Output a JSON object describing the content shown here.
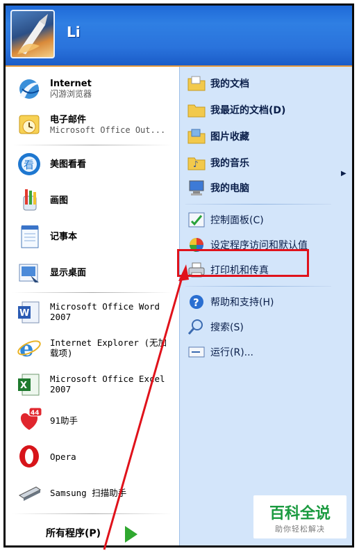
{
  "user": {
    "name": "Li"
  },
  "pinned": [
    {
      "title": "Internet",
      "subtitle": "闪游浏览器",
      "icon": "browser-icon"
    },
    {
      "title": "电子邮件",
      "subtitle": "Microsoft Office Out...",
      "icon": "outlook-icon"
    }
  ],
  "recent": [
    {
      "label": "美图看看",
      "icon": "image-viewer-icon"
    },
    {
      "label": "画图",
      "icon": "paint-icon"
    },
    {
      "label": "记事本",
      "icon": "notepad-icon"
    },
    {
      "label": "显示桌面",
      "icon": "show-desktop-icon"
    }
  ],
  "recent2": [
    {
      "line1": "Microsoft Office Word",
      "line2": "2007",
      "icon": "word-icon"
    },
    {
      "line1": "Internet Explorer (无加",
      "line2": "载项)",
      "icon": "ie-icon"
    },
    {
      "line1": "Microsoft Office Excel",
      "line2": "2007",
      "icon": "excel-icon"
    },
    {
      "line1": "91助手",
      "line2": "",
      "icon": "91-assistant-icon",
      "badge": "44"
    },
    {
      "line1": "Opera",
      "line2": "",
      "icon": "opera-icon"
    },
    {
      "line1": "Samsung 扫描助手",
      "line2": "",
      "icon": "scanner-icon"
    }
  ],
  "all_programs": "所有程序(P)",
  "right": {
    "group1": [
      {
        "label": "我的文档",
        "icon": "folder-docs-icon"
      },
      {
        "label": "我最近的文档(D)",
        "icon": "folder-recent-icon",
        "submenu": true
      },
      {
        "label": "图片收藏",
        "icon": "folder-pictures-icon"
      },
      {
        "label": "我的音乐",
        "icon": "folder-music-icon"
      },
      {
        "label": "我的电脑",
        "icon": "computer-icon"
      }
    ],
    "group2": [
      {
        "label": "控制面板(C)",
        "icon": "control-panel-icon"
      },
      {
        "label": "设定程序访问和默认值",
        "icon": "program-defaults-icon"
      },
      {
        "label": "打印机和传真",
        "icon": "printer-icon"
      }
    ],
    "group3": [
      {
        "label": "帮助和支持(H)",
        "icon": "help-icon"
      },
      {
        "label": "搜索(S)",
        "icon": "search-icon"
      },
      {
        "label": "运行(R)...",
        "icon": "run-icon"
      }
    ]
  },
  "watermark": {
    "title": "百科全说",
    "subtitle": "助你轻松解决"
  },
  "colors": {
    "header": "#2a73dc",
    "right_panel": "#d3e5fa",
    "highlight": "#e0121b",
    "watermark_green": "#1a9a3f"
  }
}
